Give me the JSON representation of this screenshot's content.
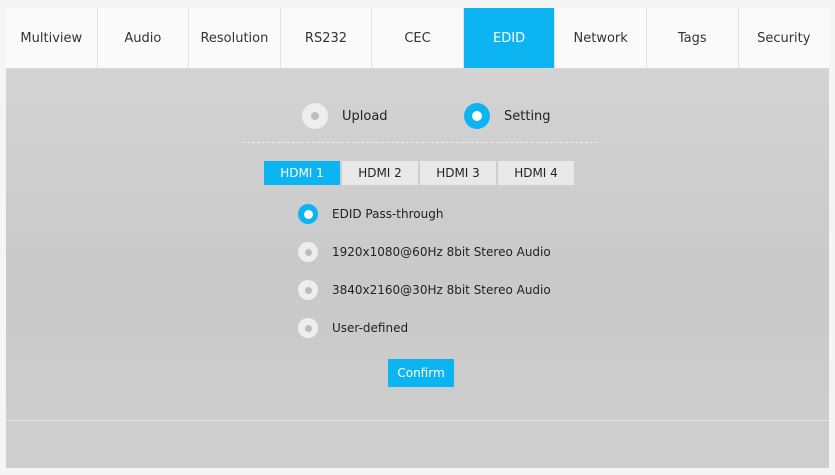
{
  "tabs": [
    {
      "label": "Multiview"
    },
    {
      "label": "Audio"
    },
    {
      "label": "Resolution"
    },
    {
      "label": "RS232"
    },
    {
      "label": "CEC"
    },
    {
      "label": "EDID"
    },
    {
      "label": "Network"
    },
    {
      "label": "Tags"
    },
    {
      "label": "Security"
    }
  ],
  "active_tab": "EDID",
  "mode": {
    "upload_label": "Upload",
    "setting_label": "Setting",
    "selected": "Setting"
  },
  "hdmi_tabs": [
    {
      "label": "HDMI 1"
    },
    {
      "label": "HDMI 2"
    },
    {
      "label": "HDMI 3"
    },
    {
      "label": "HDMI 4"
    }
  ],
  "active_hdmi": "HDMI 1",
  "edid_options": [
    {
      "label": "EDID Pass-through"
    },
    {
      "label": "1920x1080@60Hz 8bit Stereo Audio"
    },
    {
      "label": "3840x2160@30Hz 8bit Stereo Audio"
    },
    {
      "label": "User-defined"
    }
  ],
  "selected_option": "EDID Pass-through",
  "confirm_label": "Confirm",
  "colors": {
    "accent": "#0db4f2",
    "background": "#cfcfcf"
  }
}
